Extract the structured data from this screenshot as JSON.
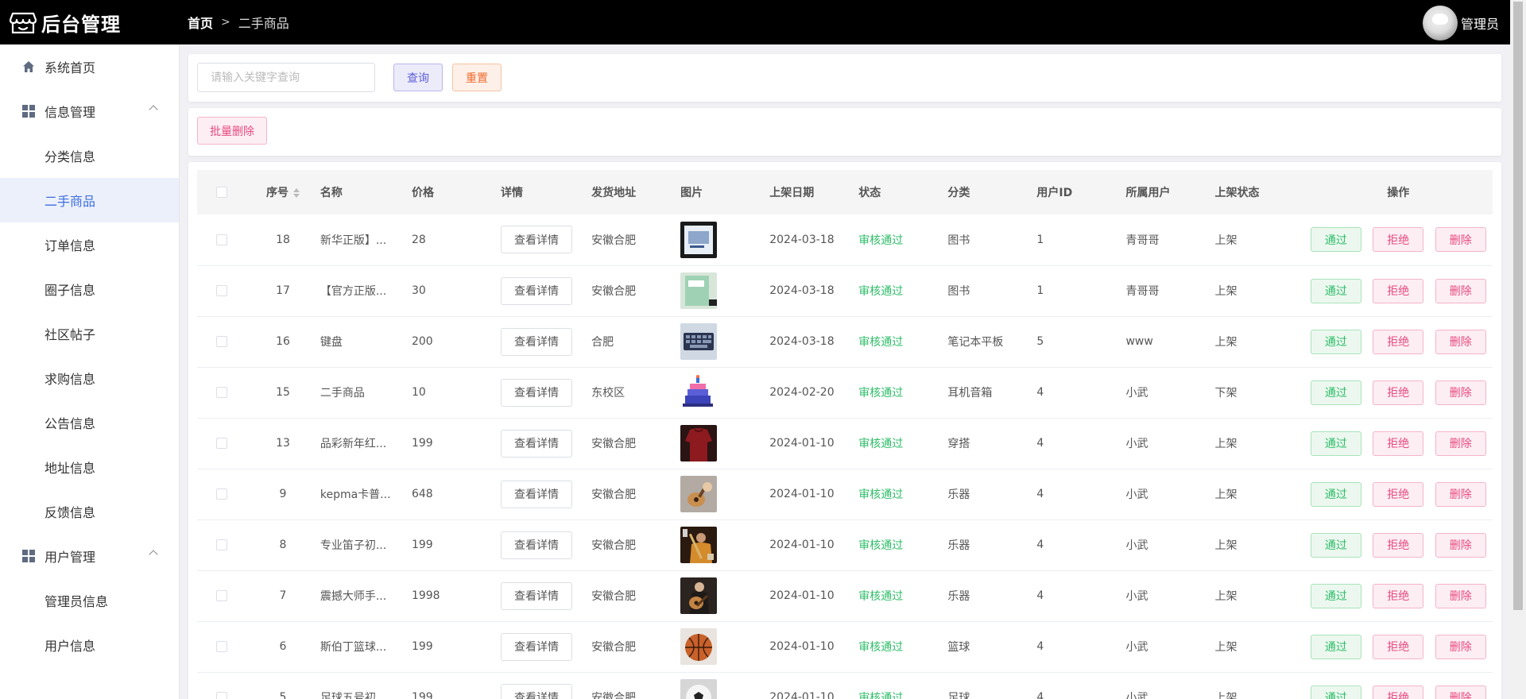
{
  "header": {
    "logo_text": "后台管理",
    "breadcrumb_home": "首页",
    "breadcrumb_sep": ">",
    "breadcrumb_current": "二手商品",
    "user_name": "管理员"
  },
  "sidebar": {
    "home": "系统首页",
    "group_info": "信息管理",
    "info_items": [
      "分类信息",
      "二手商品",
      "订单信息",
      "圈子信息",
      "社区帖子",
      "求购信息",
      "公告信息",
      "地址信息",
      "反馈信息"
    ],
    "group_user": "用户管理",
    "user_items": [
      "管理员信息",
      "用户信息"
    ],
    "active_item": "二手商品"
  },
  "search": {
    "placeholder": "请输入关键字查询",
    "query_label": "查询",
    "reset_label": "重置",
    "batch_delete_label": "批量删除"
  },
  "table": {
    "columns": [
      "序号",
      "名称",
      "价格",
      "详情",
      "发货地址",
      "图片",
      "上架日期",
      "状态",
      "分类",
      "用户ID",
      "所属用户",
      "上架状态",
      "操作"
    ],
    "detail_label": "查看详情",
    "op_pass": "通过",
    "op_reject": "拒绝",
    "op_delete": "删除",
    "rows": [
      {
        "id": "18",
        "name": "新华正版】...",
        "price": "28",
        "address": "安徽合肥",
        "date": "2024-03-18",
        "status": "审核通过",
        "category": "图书",
        "user_id": "1",
        "user": "青哥哥",
        "shelf": "上架",
        "img": "book-blue"
      },
      {
        "id": "17",
        "name": "【官方正版...",
        "price": "30",
        "address": "安徽合肥",
        "date": "2024-03-18",
        "status": "审核通过",
        "category": "图书",
        "user_id": "1",
        "user": "青哥哥",
        "shelf": "上架",
        "img": "book-green"
      },
      {
        "id": "16",
        "name": "键盘",
        "price": "200",
        "address": "合肥",
        "date": "2024-03-18",
        "status": "审核通过",
        "category": "笔记本平板",
        "user_id": "5",
        "user": "www",
        "shelf": "上架",
        "img": "keyboard"
      },
      {
        "id": "15",
        "name": "二手商品",
        "price": "10",
        "address": "东校区",
        "date": "2024-02-20",
        "status": "审核通过",
        "category": "耳机音箱",
        "user_id": "4",
        "user": "小武",
        "shelf": "下架",
        "img": "cake"
      },
      {
        "id": "13",
        "name": "品彩新年红...",
        "price": "199",
        "address": "安徽合肥",
        "date": "2024-01-10",
        "status": "审核通过",
        "category": "穿搭",
        "user_id": "4",
        "user": "小武",
        "shelf": "上架",
        "img": "red-sweater"
      },
      {
        "id": "9",
        "name": "kepma卡普...",
        "price": "648",
        "address": "安徽合肥",
        "date": "2024-01-10",
        "status": "审核通过",
        "category": "乐器",
        "user_id": "4",
        "user": "小武",
        "shelf": "上架",
        "img": "guitar-1"
      },
      {
        "id": "8",
        "name": "专业笛子初...",
        "price": "199",
        "address": "安徽合肥",
        "date": "2024-01-10",
        "status": "审核通过",
        "category": "乐器",
        "user_id": "4",
        "user": "小武",
        "shelf": "上架",
        "img": "flute"
      },
      {
        "id": "7",
        "name": "震撼大师手...",
        "price": "1998",
        "address": "安徽合肥",
        "date": "2024-01-10",
        "status": "审核通过",
        "category": "乐器",
        "user_id": "4",
        "user": "小武",
        "shelf": "上架",
        "img": "guitar-2"
      },
      {
        "id": "6",
        "name": "斯伯丁篮球...",
        "price": "199",
        "address": "安徽合肥",
        "date": "2024-01-10",
        "status": "审核通过",
        "category": "篮球",
        "user_id": "4",
        "user": "小武",
        "shelf": "上架",
        "img": "basketball"
      },
      {
        "id": "5",
        "name": "足球五号初...",
        "price": "199",
        "address": "安徽合肥",
        "date": "2024-01-10",
        "status": "审核通过",
        "category": "足球",
        "user_id": "4",
        "user": "小武",
        "shelf": "上架",
        "img": "football"
      }
    ]
  },
  "colors": {
    "header_bg": "#000000",
    "active_menu_bg": "#ecf0fb",
    "active_menu_text": "#3d6ee0",
    "status_green": "#2ebd68",
    "danger_pink": "#e84a7f",
    "query_purple": "#5d5fd6",
    "reset_orange": "#f06b2d"
  }
}
